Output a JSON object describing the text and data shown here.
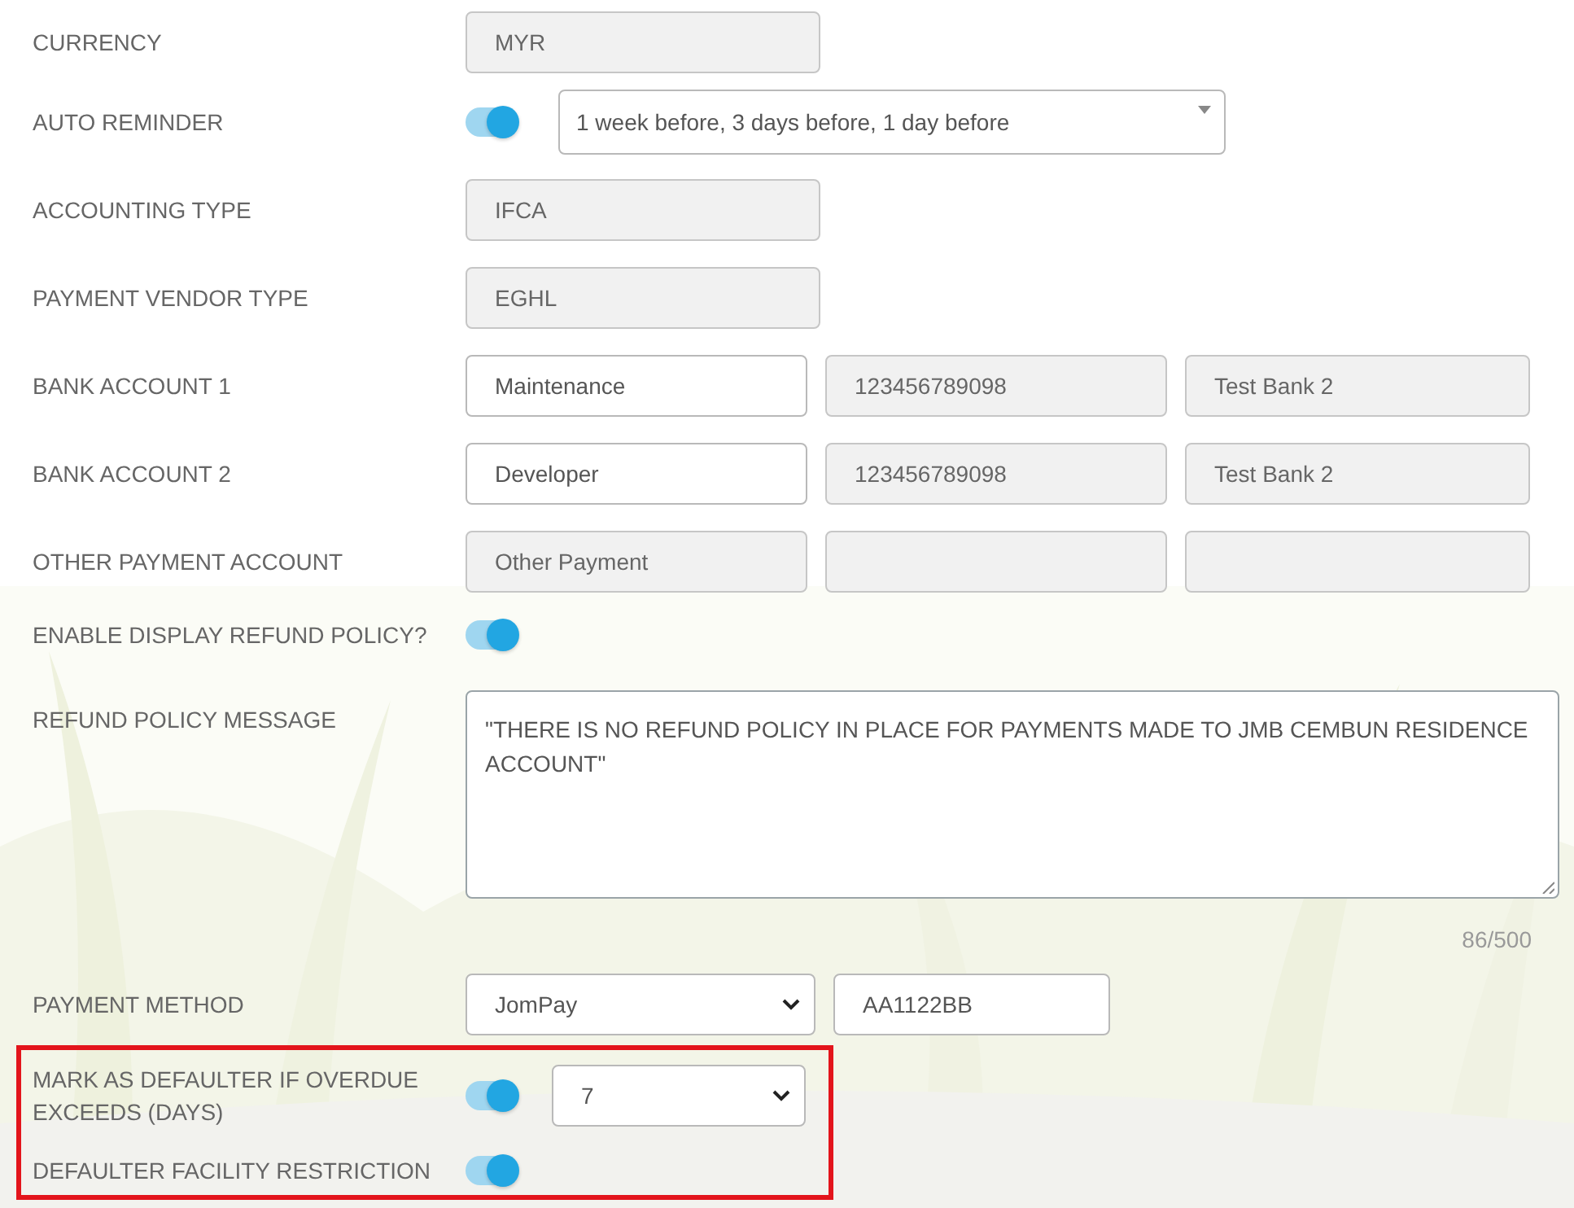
{
  "rows": [
    {
      "kind": "fields",
      "label": "CURRENCY",
      "fields": [
        {
          "kind": "input",
          "value": "MYR",
          "readonly": true
        }
      ]
    },
    {
      "kind": "toggle-select",
      "label": "AUTO REMINDER",
      "on": true,
      "fields": [
        {
          "kind": "multiselect",
          "value": "1 week before, 3 days before, 1 day before",
          "readonly": false
        }
      ]
    },
    {
      "kind": "fields",
      "label": "ACCOUNTING TYPE",
      "fields": [
        {
          "kind": "input",
          "value": "IFCA",
          "readonly": true
        }
      ]
    },
    {
      "kind": "fields",
      "label": "PAYMENT VENDOR TYPE",
      "fields": [
        {
          "kind": "input",
          "value": "EGHL",
          "readonly": true
        }
      ]
    },
    {
      "kind": "fields",
      "label": "BANK ACCOUNT 1",
      "fields": [
        {
          "kind": "input",
          "value": "Maintenance",
          "readonly": false
        },
        {
          "kind": "input",
          "value": "123456789098",
          "readonly": true
        },
        {
          "kind": "input",
          "value": "Test Bank 2",
          "readonly": true
        }
      ]
    },
    {
      "kind": "fields",
      "label": "BANK ACCOUNT 2",
      "fields": [
        {
          "kind": "input",
          "value": "Developer",
          "readonly": false
        },
        {
          "kind": "input",
          "value": "123456789098",
          "readonly": true
        },
        {
          "kind": "input",
          "value": "Test Bank 2",
          "readonly": true
        }
      ]
    },
    {
      "kind": "fields",
      "label": "OTHER PAYMENT ACCOUNT",
      "fields": [
        {
          "kind": "input",
          "value": "Other Payment",
          "readonly": true
        },
        {
          "kind": "input",
          "readonly": true
        },
        {
          "kind": "input",
          "readonly": true
        }
      ]
    },
    {
      "kind": "toggle",
      "label": "ENABLE DISPLAY REFUND POLICY?",
      "on": true
    },
    {
      "kind": "textarea",
      "label": "REFUND POLICY MESSAGE",
      "value": "\"THERE IS NO REFUND POLICY IN PLACE FOR PAYMENTS MADE TO JMB CEMBUN RESIDENCE ACCOUNT\"",
      "counter": "86/500"
    },
    {
      "kind": "fields",
      "label": "PAYMENT METHOD",
      "fields": [
        {
          "kind": "select",
          "value": "JomPay",
          "readonly": false
        },
        {
          "kind": "input",
          "value": "AA1122BB",
          "readonly": false
        }
      ]
    }
  ],
  "highlighted_rows": [
    {
      "kind": "toggle-select",
      "label": "MARK AS DEFAULTER IF OVERDUE EXCEEDS (DAYS)",
      "on": true,
      "fields": [
        {
          "kind": "select",
          "value": "7",
          "readonly": false
        }
      ]
    },
    {
      "kind": "toggle",
      "label": "DEFAULTER FACILITY RESTRICTION",
      "on": true
    }
  ]
}
